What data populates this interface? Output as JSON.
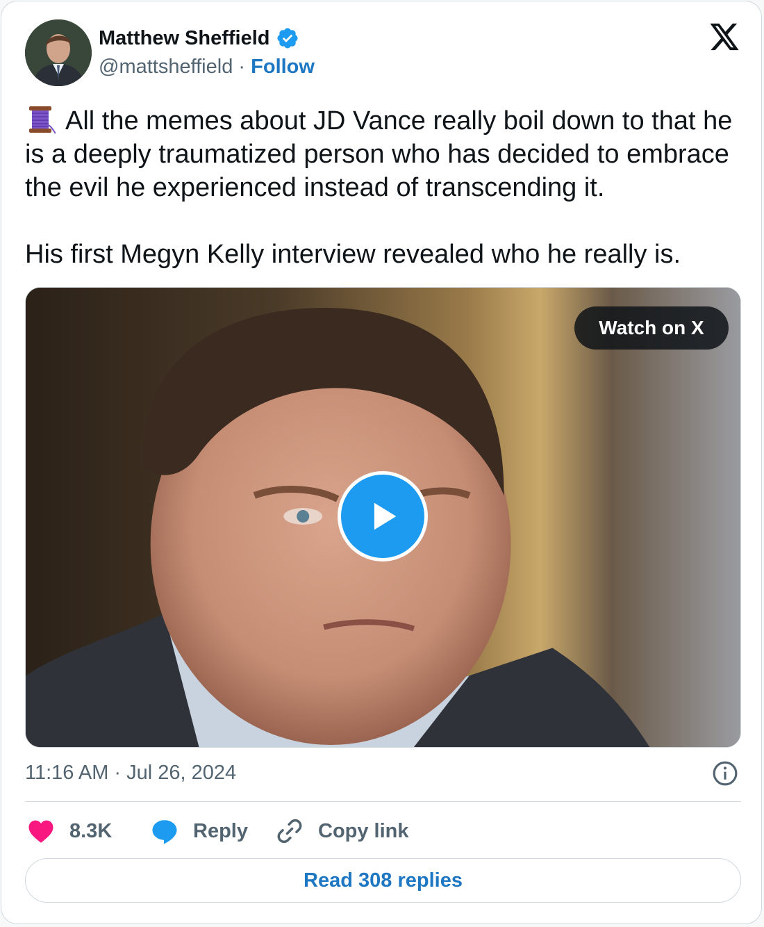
{
  "author": {
    "name": "Matthew Sheffield",
    "handle": "@mattsheffield",
    "separator": "·",
    "follow_label": "Follow",
    "verified": true
  },
  "tweet": {
    "paragraphs": [
      "All the memes about JD Vance really boil down to that he is a deeply traumatized person who has decided to embrace the evil he experienced instead of transcending it.",
      "His first Megyn Kelly interview revealed who he really is."
    ],
    "leading_emoji": "spool-of-thread"
  },
  "media": {
    "watch_label": "Watch on X",
    "play_icon": "play-icon"
  },
  "timestamp": "11:16 AM · Jul 26, 2024",
  "actions": {
    "like_count": "8.3K",
    "reply_label": "Reply",
    "copy_label": "Copy link"
  },
  "read_replies_label": "Read 308 replies",
  "colors": {
    "link": "#1d77c2",
    "secondary_text": "#536471",
    "like": "#f91880",
    "reply": "#1d9bf0",
    "play": "#1d9bf0"
  }
}
